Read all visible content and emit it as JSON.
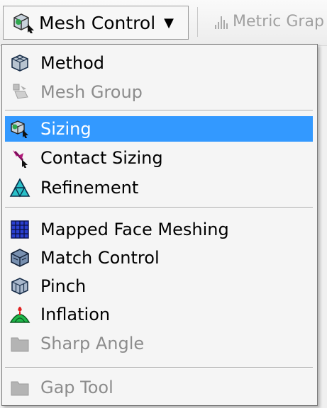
{
  "toolbar": {
    "mesh_control_label": "Mesh Control",
    "metric_label": "Metric Grap"
  },
  "menu": {
    "items": [
      {
        "label": "Method",
        "icon": "method-cube-icon",
        "enabled": true
      },
      {
        "label": "Mesh Group",
        "icon": "mesh-group-icon",
        "enabled": false
      },
      {
        "label": "Sizing",
        "icon": "sizing-icon",
        "enabled": true,
        "selected": true
      },
      {
        "label": "Contact Sizing",
        "icon": "contact-sizing-icon",
        "enabled": true
      },
      {
        "label": "Refinement",
        "icon": "refinement-icon",
        "enabled": true
      },
      {
        "label": "Mapped Face Meshing",
        "icon": "mapped-face-icon",
        "enabled": true
      },
      {
        "label": "Match Control",
        "icon": "match-control-icon",
        "enabled": true
      },
      {
        "label": "Pinch",
        "icon": "pinch-icon",
        "enabled": true
      },
      {
        "label": "Inflation",
        "icon": "inflation-icon",
        "enabled": true
      },
      {
        "label": "Sharp Angle",
        "icon": "sharp-angle-icon",
        "enabled": false
      },
      {
        "label": "Gap Tool",
        "icon": "gap-tool-icon",
        "enabled": false
      }
    ]
  },
  "colors": {
    "selection": "#3399ff",
    "disabled_text": "#8c8c8c"
  }
}
